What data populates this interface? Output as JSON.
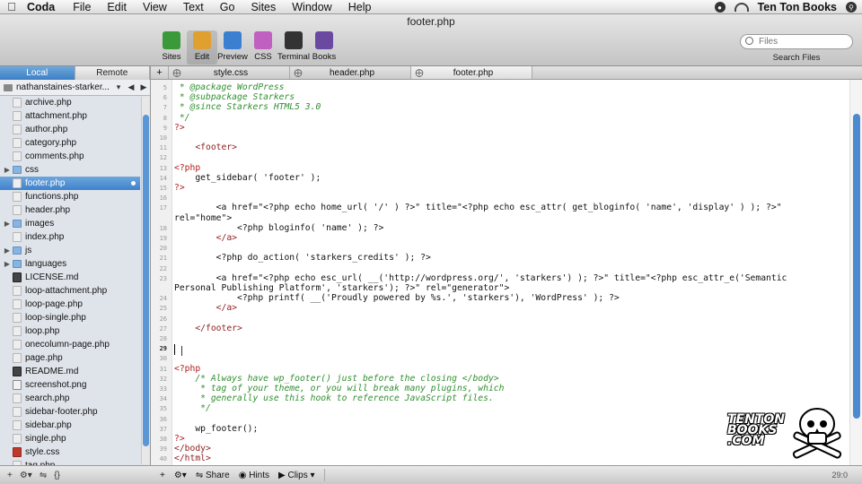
{
  "menubar": {
    "app": "Coda",
    "items": [
      "File",
      "Edit",
      "View",
      "Text",
      "Go",
      "Sites",
      "Window",
      "Help"
    ],
    "user": "Ten Ton Books"
  },
  "window": {
    "title": "footer.php"
  },
  "toolbar": {
    "buttons": [
      {
        "label": "Sites",
        "icon": "sites-icon",
        "color": "#3a9a3a"
      },
      {
        "label": "Edit",
        "icon": "edit-pencil-icon",
        "color": "#e0a030"
      },
      {
        "label": "Preview",
        "icon": "preview-globe-icon",
        "color": "#3b7fd0"
      },
      {
        "label": "CSS",
        "icon": "css-palette-icon",
        "color": "#c060c0"
      },
      {
        "label": "Terminal",
        "icon": "terminal-icon",
        "color": "#333333"
      },
      {
        "label": "Books",
        "icon": "books-icon",
        "color": "#6a4aa0"
      }
    ],
    "search_placeholder": "Files",
    "search_label": "Search Files"
  },
  "sidebar": {
    "tabs": [
      "Local",
      "Remote"
    ],
    "path": "nathanstaines-starker...",
    "files": [
      {
        "name": "archive.php",
        "type": "php"
      },
      {
        "name": "attachment.php",
        "type": "php"
      },
      {
        "name": "author.php",
        "type": "php"
      },
      {
        "name": "category.php",
        "type": "php"
      },
      {
        "name": "comments.php",
        "type": "php"
      },
      {
        "name": "css",
        "type": "folder"
      },
      {
        "name": "footer.php",
        "type": "php",
        "selected": true
      },
      {
        "name": "functions.php",
        "type": "php"
      },
      {
        "name": "header.php",
        "type": "php"
      },
      {
        "name": "images",
        "type": "folder"
      },
      {
        "name": "index.php",
        "type": "php"
      },
      {
        "name": "js",
        "type": "folder"
      },
      {
        "name": "languages",
        "type": "folder"
      },
      {
        "name": "LICENSE.md",
        "type": "txt"
      },
      {
        "name": "loop-attachment.php",
        "type": "php"
      },
      {
        "name": "loop-page.php",
        "type": "php"
      },
      {
        "name": "loop-single.php",
        "type": "php"
      },
      {
        "name": "loop.php",
        "type": "php"
      },
      {
        "name": "onecolumn-page.php",
        "type": "php"
      },
      {
        "name": "page.php",
        "type": "php"
      },
      {
        "name": "README.md",
        "type": "txt"
      },
      {
        "name": "screenshot.png",
        "type": "png"
      },
      {
        "name": "search.php",
        "type": "php"
      },
      {
        "name": "sidebar-footer.php",
        "type": "php"
      },
      {
        "name": "sidebar.php",
        "type": "php"
      },
      {
        "name": "single.php",
        "type": "php"
      },
      {
        "name": "style.css",
        "type": "css"
      },
      {
        "name": "tag.php",
        "type": "php"
      }
    ]
  },
  "tabs": [
    "style.css",
    "header.php",
    "footer.php"
  ],
  "editor": {
    "current_line": 29,
    "lines": [
      {
        "n": "5",
        "t": " * @package WordPress",
        "k": "c"
      },
      {
        "n": "6",
        "t": " * @subpackage Starkers",
        "k": "c"
      },
      {
        "n": "7",
        "t": " * @since Starkers HTML5 3.0",
        "k": "c"
      },
      {
        "n": "8",
        "t": " */",
        "k": "c"
      },
      {
        "n": "9",
        "t": "?>",
        "k": "k"
      },
      {
        "n": "10",
        "t": "",
        "k": ""
      },
      {
        "n": "11",
        "t": "    <footer>",
        "k": "t2"
      },
      {
        "n": "12",
        "t": "",
        "k": ""
      },
      {
        "n": "13",
        "t": "<?php",
        "k": "k"
      },
      {
        "n": "14",
        "t": "    get_sidebar( 'footer' );",
        "k": ""
      },
      {
        "n": "15",
        "t": "?>",
        "k": "k"
      },
      {
        "n": "16",
        "t": "",
        "k": ""
      },
      {
        "n": "17",
        "t": "        <a href=\"<?php echo home_url( '/' ) ?>\" title=\"<?php echo esc_attr( get_bloginfo( 'name', 'display' ) ); ?>\"",
        "k": ""
      },
      {
        "n": "",
        "t": "rel=\"home\">",
        "k": ""
      },
      {
        "n": "18",
        "t": "            <?php bloginfo( 'name' ); ?>",
        "k": ""
      },
      {
        "n": "19",
        "t": "        </a>",
        "k": "t2"
      },
      {
        "n": "20",
        "t": "",
        "k": ""
      },
      {
        "n": "21",
        "t": "        <?php do_action( 'starkers_credits' ); ?>",
        "k": ""
      },
      {
        "n": "22",
        "t": "",
        "k": ""
      },
      {
        "n": "23",
        "t": "        <a href=\"<?php echo esc_url( __('http://wordpress.org/', 'starkers') ); ?>\" title=\"<?php esc_attr_e('Semantic",
        "k": ""
      },
      {
        "n": "",
        "t": "Personal Publishing Platform', 'starkers'); ?>\" rel=\"generator\">",
        "k": ""
      },
      {
        "n": "24",
        "t": "            <?php printf( __('Proudly powered by %s.', 'starkers'), 'WordPress' ); ?>",
        "k": ""
      },
      {
        "n": "25",
        "t": "        </a>",
        "k": "t2"
      },
      {
        "n": "26",
        "t": "",
        "k": ""
      },
      {
        "n": "27",
        "t": "    </footer>",
        "k": "t2"
      },
      {
        "n": "28",
        "t": "",
        "k": ""
      },
      {
        "n": "29",
        "t": "",
        "k": ""
      },
      {
        "n": "30",
        "t": "",
        "k": ""
      },
      {
        "n": "31",
        "t": "<?php",
        "k": "k"
      },
      {
        "n": "32",
        "t": "    /* Always have wp_footer() just before the closing </body>",
        "k": "c"
      },
      {
        "n": "33",
        "t": "     * tag of your theme, or you will break many plugins, which",
        "k": "c"
      },
      {
        "n": "34",
        "t": "     * generally use this hook to reference JavaScript files.",
        "k": "c"
      },
      {
        "n": "35",
        "t": "     */",
        "k": "c"
      },
      {
        "n": "36",
        "t": "",
        "k": ""
      },
      {
        "n": "37",
        "t": "    wp_footer();",
        "k": ""
      },
      {
        "n": "38",
        "t": "?>",
        "k": "k"
      },
      {
        "n": "39",
        "t": "</body>",
        "k": "t2"
      },
      {
        "n": "40",
        "t": "</html>",
        "k": "t2"
      }
    ]
  },
  "watermark": {
    "text": "TENTON\nBOOKS\n.COM"
  },
  "statusbar": {
    "share": "Share",
    "hints": "Hints",
    "clips": "Clips",
    "position": "29:0"
  }
}
